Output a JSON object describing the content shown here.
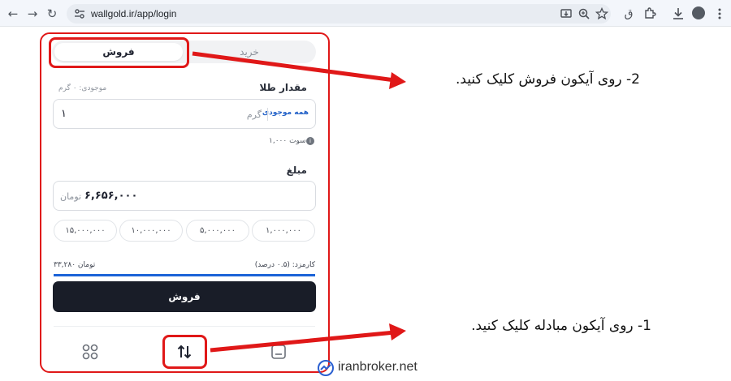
{
  "browser": {
    "url": "wallgold.ir/app/login",
    "site_icon": "tune-icon",
    "back_icon": "←",
    "forward_icon": "→",
    "reload_icon": "↻",
    "translate_glyph": "ق"
  },
  "tabs": {
    "buy": "خرید",
    "sell": "فروش"
  },
  "gold": {
    "label": "مقدار طلا",
    "balance": "موجودی: ۰ گرم",
    "all_button": "همه موجودی",
    "unit": "گرم",
    "value": "۱",
    "hint": "۱,۰۰۰ سوت",
    "info_glyph": "i"
  },
  "amount": {
    "label": "مبلغ",
    "value": "۶,۶۵۶,۰۰۰",
    "unit": "تومان"
  },
  "chips": [
    "۱۵,۰۰۰,۰۰۰",
    "۱۰,۰۰۰,۰۰۰",
    "۵,۰۰۰,۰۰۰",
    "۱,۰۰۰,۰۰۰"
  ],
  "fee": {
    "label": "کارمزد: (۰.۵ درصد)",
    "value": "۳۳,۲۸۰ تومان"
  },
  "sell_button": "فروش",
  "callouts": {
    "step2": "2- روی آیکون فروش کلیک کنید.",
    "step1": "1- روی آیکون مبادله کلیک کنید."
  },
  "brand": {
    "name": "iranbroker.net"
  },
  "colors": {
    "highlight": "#e01818",
    "accent_blue": "#1b63d8",
    "button_dark": "#191d28"
  }
}
